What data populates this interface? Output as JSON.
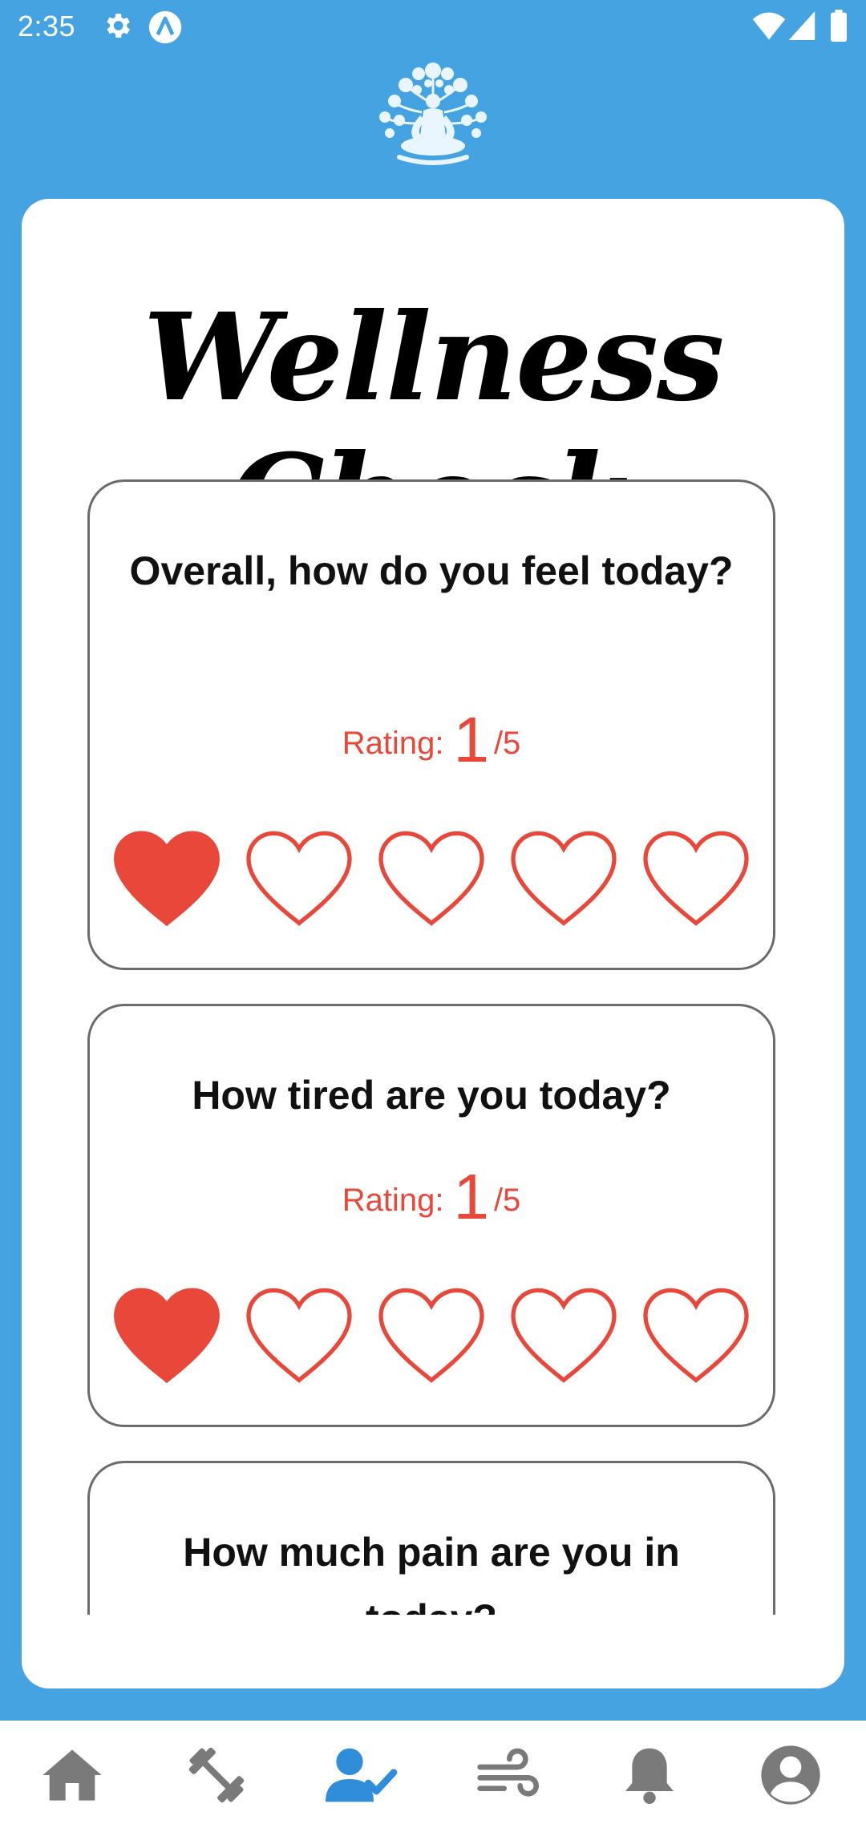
{
  "status_bar": {
    "time": "2:35"
  },
  "page": {
    "title": "Wellness Check"
  },
  "questions": [
    {
      "text": "Overall, how do you feel today?",
      "rating_label": "Rating:",
      "rating_value": "1",
      "rating_max": "/5",
      "hearts_filled": 1,
      "hearts_total": 5
    },
    {
      "text": "How tired are you today?",
      "rating_label": "Rating:",
      "rating_value": "1",
      "rating_max": "/5",
      "hearts_filled": 1,
      "hearts_total": 5
    },
    {
      "text": "How much pain are you in today?"
    }
  ],
  "nav": {
    "items": [
      {
        "icon": "home-icon",
        "active": false
      },
      {
        "icon": "dumbbell-icon",
        "active": false
      },
      {
        "icon": "user-check-icon",
        "active": true
      },
      {
        "icon": "wind-icon",
        "active": false
      },
      {
        "icon": "bell-icon",
        "active": false
      },
      {
        "icon": "profile-icon",
        "active": false
      }
    ]
  },
  "colors": {
    "background": "#46A3E2",
    "accent": "#E8473A",
    "active_nav": "#2F8DDA",
    "inactive_nav": "#7A7A7A"
  }
}
